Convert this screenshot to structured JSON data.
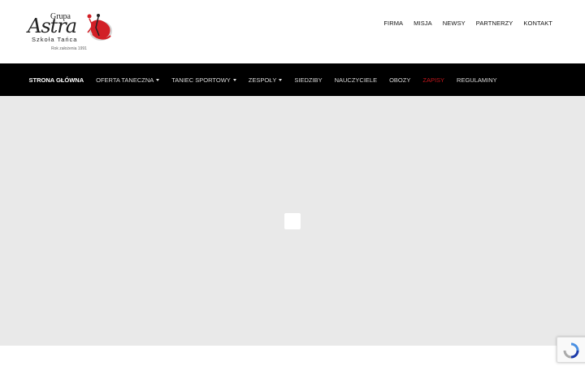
{
  "logo": {
    "grupa": "Grupa",
    "astra": "Astra",
    "school": "Szkoła Tańca",
    "since": "Rok założenia 1991"
  },
  "top_nav": [
    "FIRMA",
    "MISJA",
    "NEWSY",
    "PARTNERZY",
    "KONTAKT"
  ],
  "main_nav": [
    {
      "label": "STRONA GŁÓWNA",
      "state": "active"
    },
    {
      "label": "OFERTA TANECZNA",
      "dropdown": true
    },
    {
      "label": "TANIEC SPORTOWY",
      "dropdown": true
    },
    {
      "label": "ZESPOŁY",
      "dropdown": true
    },
    {
      "label": "SIEDZIBY"
    },
    {
      "label": "NAUCZYCIELE"
    },
    {
      "label": "OBOZY"
    },
    {
      "label": "ZAPISY",
      "state": "accent"
    },
    {
      "label": "REGULAMINY"
    }
  ],
  "colors": {
    "nav_bg": "#000000",
    "accent": "#c4161c",
    "hero_bg": "#e9e9e9"
  },
  "icons": {
    "loader": "loading-spinner-icon",
    "recaptcha": "recaptcha-icon"
  }
}
